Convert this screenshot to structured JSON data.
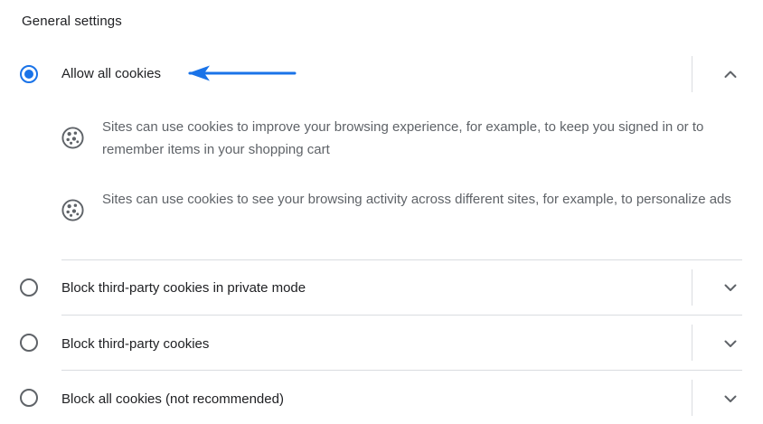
{
  "section": {
    "title": "General settings"
  },
  "options": [
    {
      "label": "Allow all cookies",
      "selected": true,
      "expanded": true,
      "details": [
        {
          "icon": "cookie-icon",
          "text": "Sites can use cookies to improve your browsing experience, for example, to keep you signed in or to remember items in your shopping cart"
        },
        {
          "icon": "cookie-icon",
          "text": "Sites can use cookies to see your browsing activity across different sites, for example, to personalize ads"
        }
      ]
    },
    {
      "label": "Block third-party cookies in private mode",
      "selected": false,
      "expanded": false
    },
    {
      "label": "Block third-party cookies",
      "selected": false,
      "expanded": false
    },
    {
      "label": "Block all cookies (not recommended)",
      "selected": false,
      "expanded": false
    }
  ],
  "colors": {
    "accent": "#1a73e8",
    "annotation_arrow": "#1a73e8",
    "text_primary": "#202124",
    "text_secondary": "#5f6368",
    "divider": "#dadce0"
  }
}
